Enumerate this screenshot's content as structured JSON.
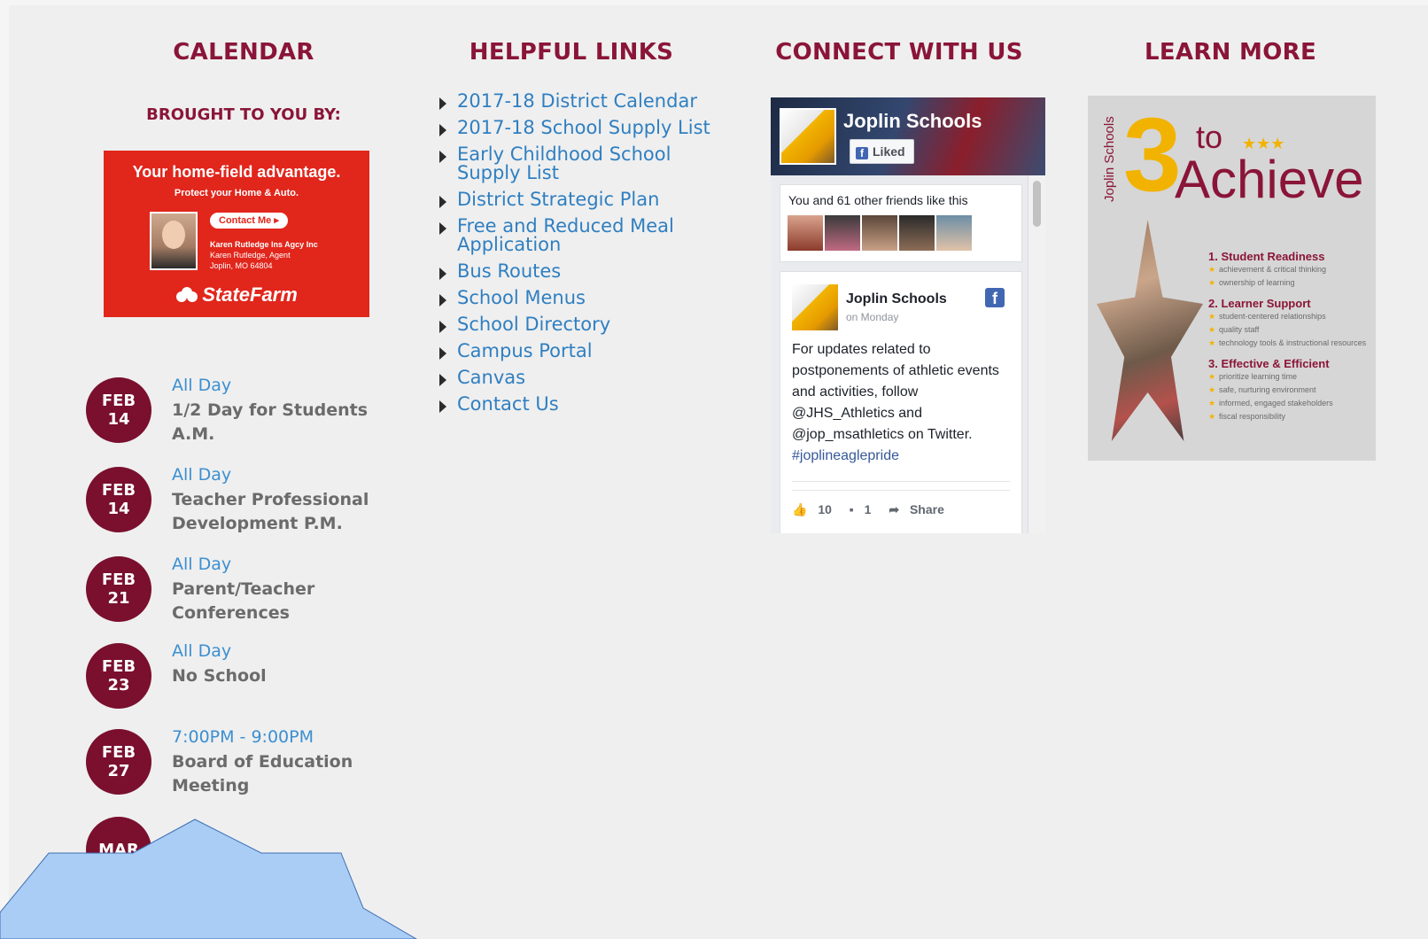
{
  "calendar": {
    "title": "CALENDAR",
    "brought_by": "BROUGHT TO YOU BY:",
    "ad": {
      "headline": "Your home-field advantage.",
      "sub": "Protect your Home & Auto.",
      "contact_label": "Contact Me ▸",
      "agency": "Karen Rutledge Ins Agcy Inc",
      "agent": "Karen Rutledge, Agent",
      "location": "Joplin, MO  64804",
      "brand": "StateFarm"
    },
    "events": [
      {
        "month": "FEB",
        "day": "14",
        "time": "All Day",
        "title": "1/2 Day for Students A.M."
      },
      {
        "month": "FEB",
        "day": "14",
        "time": "All Day",
        "title": "Teacher Professional Development P.M."
      },
      {
        "month": "FEB",
        "day": "21",
        "time": "All Day",
        "title": "Parent/Teacher Conferences"
      },
      {
        "month": "FEB",
        "day": "23",
        "time": "All Day",
        "title": "No School"
      },
      {
        "month": "FEB",
        "day": "27",
        "time": "7:00PM - 9:00PM",
        "title": "Board of Education Meeting"
      },
      {
        "month": "MAR",
        "day": "",
        "time": "",
        "title": ""
      }
    ]
  },
  "links": {
    "title": "HELPFUL LINKS",
    "items": [
      "2017-18 District Calendar",
      "2017-18 School Supply List",
      "Early Childhood School Supply List",
      "District Strategic Plan",
      "Free and Reduced Meal Application",
      "Bus Routes",
      "School Menus",
      "School Directory",
      "Campus Portal",
      "Canvas",
      "Contact Us"
    ]
  },
  "connect": {
    "title": "CONNECT WITH US",
    "page_name": "Joplin Schools",
    "liked_label": "Liked",
    "friends_text": "You and 61 other friends like this",
    "post": {
      "author": "Joplin Schools",
      "when": "on Monday",
      "body": "For updates related to postponements of athletic events and activities, follow @JHS_Athletics and @jop_msathletics on Twitter.",
      "hashtag": "#joplineaglepride",
      "likes": "10",
      "comments": "1",
      "share_label": "Share"
    }
  },
  "learn": {
    "title": "LEARN MORE",
    "poster": {
      "side": "Joplin Schools",
      "number": "3",
      "to": "to",
      "stars": "★★★",
      "achieve": "Achieve",
      "points": [
        {
          "heading": "1. Student Readiness",
          "items": [
            "achievement & critical thinking",
            "ownership of learning"
          ]
        },
        {
          "heading": "2. Learner Support",
          "items": [
            "student-centered relationships",
            "quality staff",
            "technology tools & instructional resources"
          ]
        },
        {
          "heading": "3. Effective & Efficient",
          "items": [
            "prioritize learning time",
            "safe, nurturing environment",
            "informed, engaged stakeholders",
            "fiscal responsibility"
          ]
        }
      ]
    }
  },
  "colors": {
    "heading": "#8a1538",
    "badge": "#7a0f2e",
    "link": "#2f7fc1",
    "overlay_fill": "#a9cdf5",
    "overlay_stroke": "#3f6fb5"
  }
}
